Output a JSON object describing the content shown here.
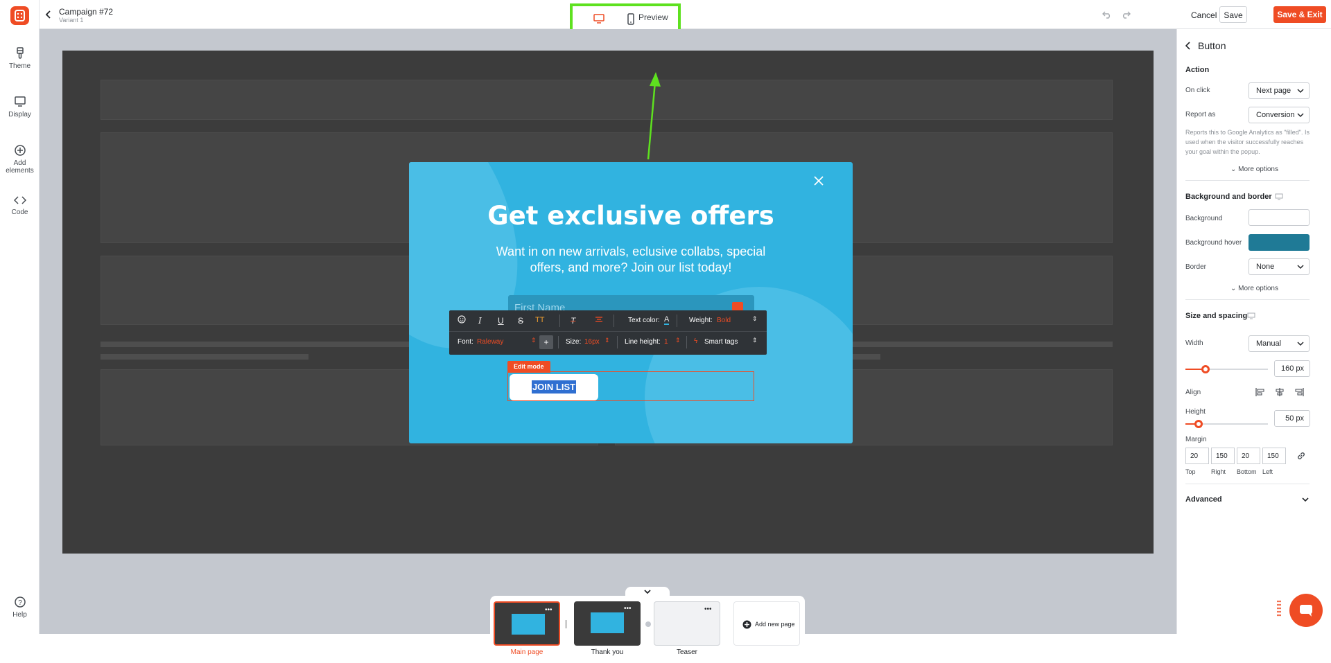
{
  "rail": {
    "items": [
      {
        "label": "Theme",
        "icon": "brush-icon"
      },
      {
        "label": "Display",
        "icon": "monitor-icon"
      },
      {
        "label": "Add elements",
        "icon": "plus-circle-icon"
      },
      {
        "label": "Code",
        "icon": "code-icon"
      }
    ],
    "help": "Help"
  },
  "topbar": {
    "campaign_title": "Campaign #72",
    "variant": "Variant 1",
    "preview": "Preview",
    "cancel": "Cancel",
    "save": "Save",
    "save_exit": "Save & Exit"
  },
  "popup": {
    "title": "Get exclusive offers",
    "text": "Want in on new arrivals, eclusive collabs, special offers, and more? Join our list today!",
    "name_placeholder": "First Name",
    "edit_mode": "Edit mode",
    "button_text": "JOIN LIST"
  },
  "toolbar": {
    "text_color": "Text color:",
    "weight_label": "Weight:",
    "weight_value": "Bold",
    "font_label": "Font:",
    "font_value": "Raleway",
    "size_label": "Size:",
    "size_value": "16px",
    "line_height_label": "Line height:",
    "line_height_value": "1",
    "smart_tags": "Smart tags",
    "tt_glyph": "TT",
    "plus": "+"
  },
  "pages": {
    "items": [
      {
        "label": "Main page",
        "active": true
      },
      {
        "label": "Thank you",
        "active": false
      },
      {
        "label": "Teaser",
        "active": false
      }
    ],
    "add": "Add new page"
  },
  "panel": {
    "title": "Button",
    "action_heading": "Action",
    "on_click_label": "On click",
    "on_click_value": "Next page",
    "report_label": "Report as",
    "report_value": "Conversion",
    "report_help": "Reports this to Google Analytics as \"filled\". Is used when the visitor successfully reaches your goal within the popup.",
    "more_options": "More options",
    "bg_heading": "Background and border",
    "bg_label": "Background",
    "bg_hover_label": "Background hover",
    "border_label": "Border",
    "border_value": "None",
    "more_options_2": "More options",
    "size_heading": "Size and spacing",
    "width_label": "Width",
    "width_value": "Manual",
    "width_px": "160 px",
    "width_pct": 0.24,
    "align_label": "Align",
    "height_label": "Height",
    "height_px": "50 px",
    "height_pct": 0.16,
    "margin_label": "Margin",
    "margin_top": "20",
    "margin_right": "150",
    "margin_bottom": "20",
    "margin_left": "150",
    "top_lbl": "Top",
    "right_lbl": "Right",
    "bottom_lbl": "Bottom",
    "left_lbl": "Left",
    "advanced": "Advanced",
    "bg_hover_color": "#1f7a96"
  },
  "colors": {
    "accent": "#ef4c24",
    "popup": "#31b3e0",
    "highlight": "#5ee11f"
  }
}
